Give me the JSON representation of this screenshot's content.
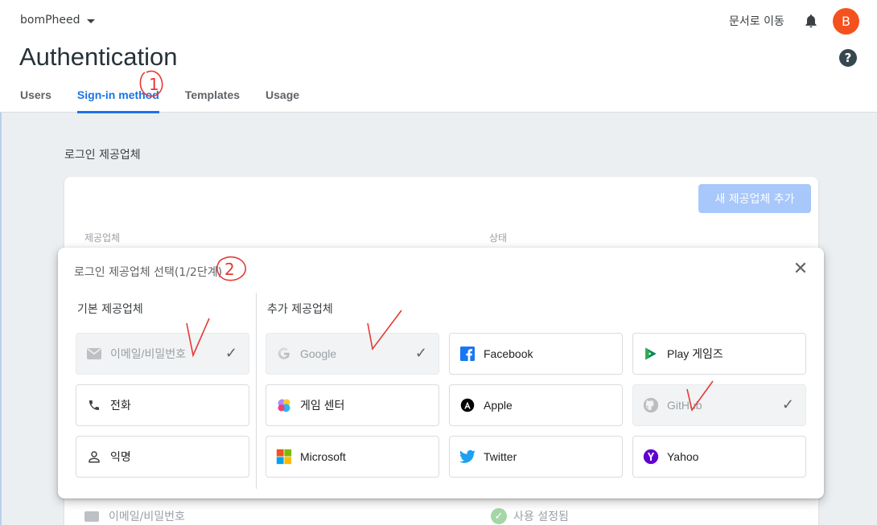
{
  "header": {
    "project_name": "bomPheed",
    "docs_link": "문서로 이동",
    "avatar_letter": "B",
    "page_title": "Authentication",
    "help_label": "?"
  },
  "tabs": [
    {
      "label": "Users",
      "active": false
    },
    {
      "label": "Sign-in method",
      "active": true
    },
    {
      "label": "Templates",
      "active": false
    },
    {
      "label": "Usage",
      "active": false
    }
  ],
  "section_label": "로그인 제공업체",
  "card": {
    "add_button": "새 제공업체 추가",
    "col_provider": "제공업체",
    "col_status": "상태",
    "row_provider": "이메일/비밀번호",
    "row_status": "사용 설정됨"
  },
  "dialog": {
    "title": "로그인 제공업체 선택(1/2단계)",
    "close_icon": "close-icon",
    "basic_label": "기본 제공업체",
    "additional_label": "추가 제공업체",
    "basic": [
      {
        "label": "이메일/비밀번호",
        "icon": "mail-icon",
        "enabled": true
      },
      {
        "label": "전화",
        "icon": "phone-icon",
        "enabled": false
      },
      {
        "label": "익명",
        "icon": "person-icon",
        "enabled": false
      }
    ],
    "additional": [
      {
        "label": "Google",
        "icon": "google-icon",
        "enabled": true
      },
      {
        "label": "Facebook",
        "icon": "facebook-icon",
        "enabled": false
      },
      {
        "label": "Play 게임즈",
        "icon": "play-games-icon",
        "enabled": false
      },
      {
        "label": "게임 센터",
        "icon": "game-center-icon",
        "enabled": false
      },
      {
        "label": "Apple",
        "icon": "apple-icon",
        "enabled": false
      },
      {
        "label": "GitHub",
        "icon": "github-icon",
        "enabled": true
      },
      {
        "label": "Microsoft",
        "icon": "microsoft-icon",
        "enabled": false
      },
      {
        "label": "Twitter",
        "icon": "twitter-icon",
        "enabled": false
      },
      {
        "label": "Yahoo",
        "icon": "yahoo-icon",
        "enabled": false
      }
    ]
  },
  "annotations": {
    "mark_1": "1",
    "mark_2": "2",
    "color": "#e53935"
  },
  "colors": {
    "accent": "#1a73e8",
    "avatar": "#f4511e",
    "add_button_disabled": "#a8c7fa"
  }
}
